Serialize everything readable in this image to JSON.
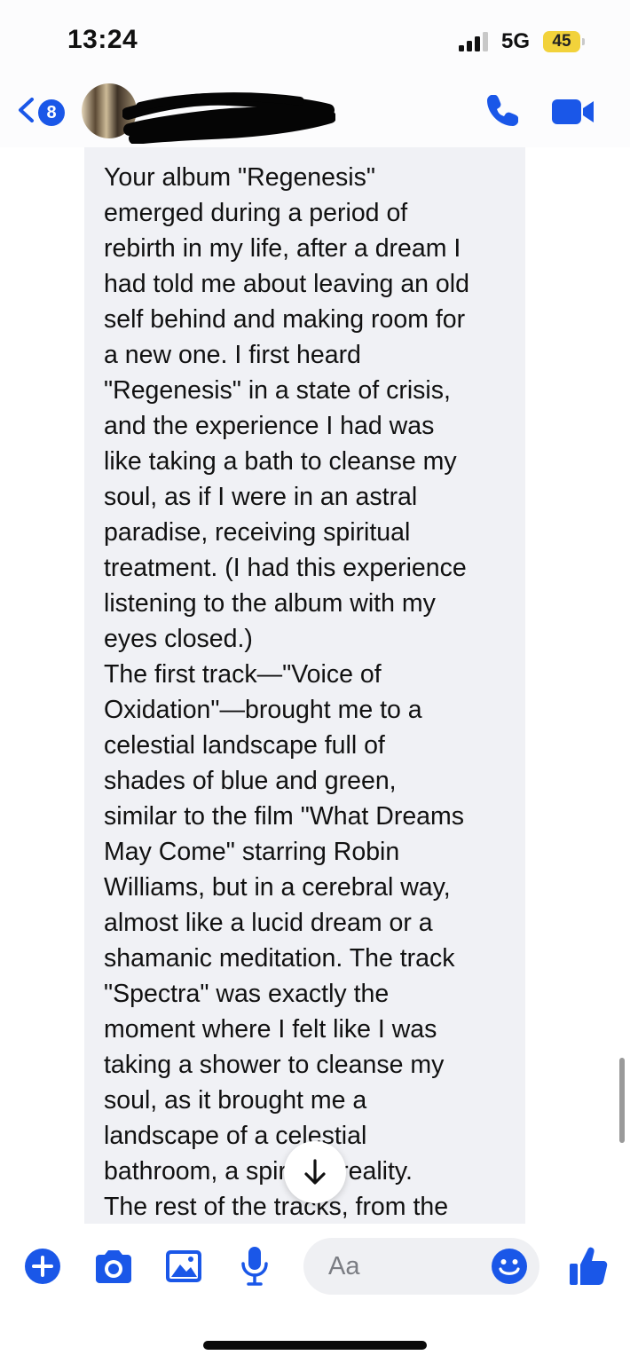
{
  "status_bar": {
    "time": "13:24",
    "network": "5G",
    "battery_level": "45",
    "battery_color": "#f2d23b"
  },
  "header": {
    "back_icon": "chevron-left-icon",
    "unread_count": "8",
    "call_icon": "phone-icon",
    "video_icon": "video-camera-icon",
    "accent_color": "#1a57e8"
  },
  "message": {
    "text": "Your album \"Regenesis\"\nemerged during a period of\nrebirth in my life, after a dream I\nhad told me about leaving an old\nself behind and making room for\na new one. I first heard\n\"Regenesis\" in a state of crisis,\nand the experience I had was\nlike taking a bath to cleanse my\nsoul, as if I were in an astral\nparadise, receiving spiritual\ntreatment. (I had this experience\nlistening to the album with my\neyes closed.)\nThe first track—\"Voice of\nOxidation\"—brought me to a\ncelestial landscape full of\nshades of blue and green,\nsimilar to the film \"What Dreams\nMay Come\" starring Robin\nWilliams, but in a cerebral way,\nalmost like a lucid dream or a\nshamanic meditation. The track\n\"Spectra\" was exactly the\nmoment where I felt like I was\ntaking a shower to cleanse my\nsoul, as it brought me a\nlandscape of a celestial\nbathroom, a spiritual reality.\nThe rest of the tracks, from the",
    "bubble_color": "#f0f1f5"
  },
  "scroll_down_icon": "arrow-down-icon",
  "composer": {
    "placeholder": "Aa",
    "icons": [
      "plus-icon",
      "camera-icon",
      "image-icon",
      "microphone-icon",
      "emoji-icon",
      "thumbs-up-icon"
    ]
  }
}
